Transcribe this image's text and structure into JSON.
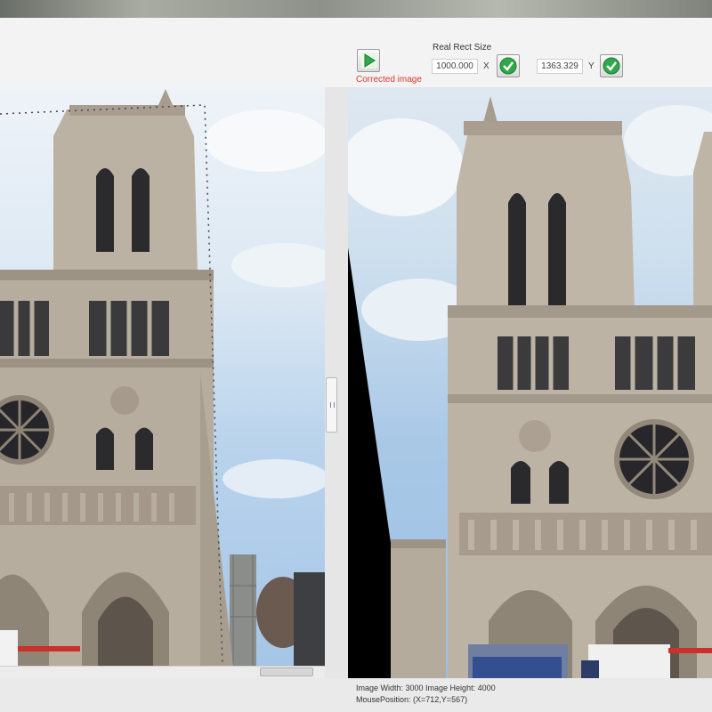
{
  "toolbar": {
    "corrected_label": "Corrected image",
    "real_rect_label": "Real Rect Size",
    "width_value": "1000.000",
    "x_label": "X",
    "height_value": "1363.329",
    "y_label": "Y",
    "play_icon": "play-icon",
    "confirm_icon": "checkmark-icon"
  },
  "status": {
    "image_size": "Image Width: 3000 Image Height: 4000",
    "mouse_position": "MousePosition: (X=712,Y=567)"
  },
  "colors": {
    "accent_green": "#2fa84a",
    "label_red": "#d43a2a"
  }
}
